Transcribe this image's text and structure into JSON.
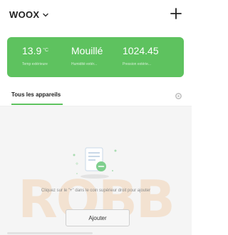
{
  "header": {
    "home_name": "WOOX",
    "add_icon": "plus-icon",
    "dropdown_icon": "chevron-down-icon"
  },
  "weather": {
    "temperature": {
      "value": "13.9",
      "unit": "°C",
      "label": "Temp extérieure"
    },
    "humidity": {
      "value": "Mouillé",
      "label": "Humidité extér..."
    },
    "pressure": {
      "value": "1024.45",
      "label": "Pression extérie..."
    },
    "color": "#5ec25f"
  },
  "tabs": {
    "all_devices": "Tous les appareils",
    "settings_icon": "gear-icon"
  },
  "empty_state": {
    "hint": "Cliquez sur le \"+\" dans le coin supérieur droit pour ajouter",
    "add_button": "Ajouter",
    "illustration_icon": "empty-device-list-icon"
  },
  "watermark": "ROBB"
}
